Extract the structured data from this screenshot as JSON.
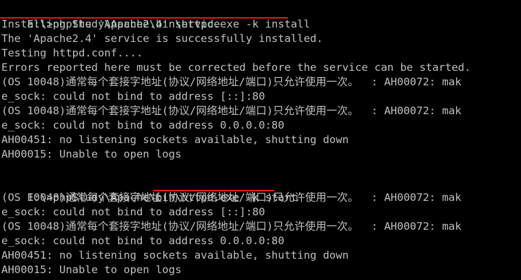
{
  "colors": {
    "background": "#000000",
    "text": "#c0c0c0",
    "annotation_underline": "#e8141b"
  },
  "lines": [
    {
      "prompt": "E:\\>phpStudy\\Apache\\bin\\",
      "command": "httpd.exe -k install"
    },
    {
      "text": "Installing the 'Apache2.4' service"
    },
    {
      "text": "The 'Apache2.4' service is successfully installed."
    },
    {
      "text": "Testing httpd.conf...."
    },
    {
      "text": "Errors reported here must be corrected before the service can be started."
    },
    {
      "text": "(OS 10048)通常每个套接字地址(协议/网络地址/端口)只允许使用一次。  : AH00072: mak"
    },
    {
      "text": "e_sock: could not bind to address [::]:80"
    },
    {
      "text": "(OS 10048)通常每个套接字地址(协议/网络地址/端口)只允许使用一次。  : AH00072: mak"
    },
    {
      "text": "e_sock: could not bind to address 0.0.0.0:80"
    },
    {
      "text": "AH00451: no listening sockets available, shutting down"
    },
    {
      "text": "AH00015: Unable to open logs"
    },
    {
      "text": ""
    },
    {
      "prompt": "E:\\>phpStudy\\Apache\\bin\\",
      "command": "httpd.exe -k start"
    },
    {
      "text": "(OS 10048)通常每个套接字地址(协议/网络地址/端口)只允许使用一次。  : AH00072: mak"
    },
    {
      "text": "e_sock: could not bind to address [::]:80"
    },
    {
      "text": "(OS 10048)通常每个套接字地址(协议/网络地址/端口)只允许使用一次。  : AH00072: mak"
    },
    {
      "text": "e_sock: could not bind to address 0.0.0.0:80"
    },
    {
      "text": "AH00451: no listening sockets available, shutting down"
    },
    {
      "text": "AH00015: Unable to open logs"
    }
  ]
}
